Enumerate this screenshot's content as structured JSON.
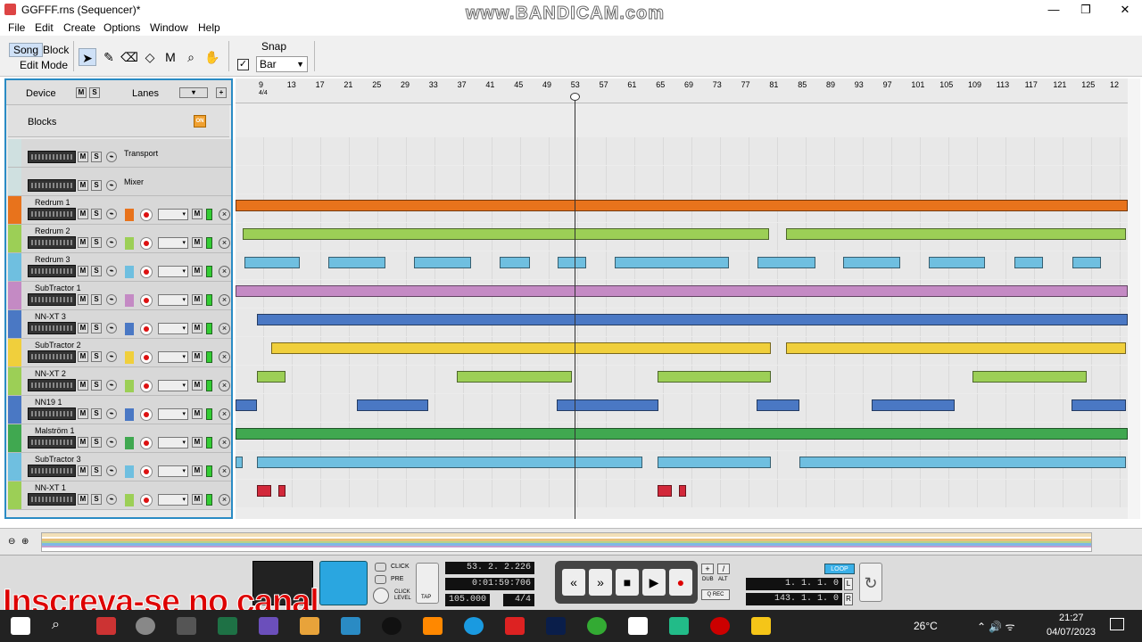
{
  "window": {
    "title": "GGFFF.rns (Sequencer)*",
    "watermark": "www.BANDICAM.com",
    "minimize": "—",
    "maximize": "❐",
    "close": "✕"
  },
  "menu": [
    "File",
    "Edit",
    "Create",
    "Options",
    "Window",
    "Help"
  ],
  "toolbar": {
    "song": "Song",
    "block": "Block",
    "edit_mode": "Edit Mode",
    "snap_label": "Snap",
    "snap_checked": true,
    "snap_value": "Bar"
  },
  "tools": [
    "arrow-tool",
    "pencil-tool",
    "eraser-tool",
    "razor-tool",
    "mute-tool",
    "magnify-tool",
    "hand-tool"
  ],
  "device_panel": {
    "device": "Device",
    "lanes": "Lanes",
    "blocks": "Blocks",
    "blocks_on": "ON"
  },
  "tracks": [
    {
      "name": "Transport",
      "color": "#b0d8d8"
    },
    {
      "name": "Mixer",
      "color": "#b0d8d8"
    },
    {
      "name": "Redrum 1",
      "color": "#e8731c"
    },
    {
      "name": "Redrum 2",
      "color": "#9ccf56"
    },
    {
      "name": "Redrum 3",
      "color": "#6fbfe0"
    },
    {
      "name": "SubTractor 1",
      "color": "#c48ac4"
    },
    {
      "name": "NN-XT 3",
      "color": "#4a78c4"
    },
    {
      "name": "SubTractor 2",
      "color": "#f0cf3c"
    },
    {
      "name": "NN-XT 2",
      "color": "#9ccf56"
    },
    {
      "name": "NN19 1",
      "color": "#4a78c4"
    },
    {
      "name": "Malström 1",
      "color": "#40a850"
    },
    {
      "name": "SubTractor 3",
      "color": "#6fbfe0"
    },
    {
      "name": "NN-XT 1",
      "color": "#9ccf56"
    }
  ],
  "ruler": {
    "bars": [
      "9",
      "13",
      "17",
      "21",
      "25",
      "29",
      "33",
      "37",
      "41",
      "45",
      "49",
      "53",
      "57",
      "61",
      "65",
      "69",
      "73",
      "77",
      "81",
      "85",
      "89",
      "93",
      "97",
      "101",
      "105",
      "109",
      "113",
      "117",
      "121",
      "125",
      "12"
    ],
    "signature": "4/4"
  },
  "transport": {
    "position": "53. 2. 2.226",
    "time": "0:01:59:706",
    "tempo": "105.000",
    "signature": "4/4",
    "left_locator": "1. 1. 1.   0",
    "right_locator": "143. 1. 1.   0",
    "click": "CLICK",
    "pre": "PRE",
    "click_level": "CLICK LEVEL",
    "tap": "TAP",
    "loop": "LOOP",
    "dub": "DUB",
    "alt": "ALT",
    "q_rec": "Q REC",
    "locator_l": "L",
    "locator_r": "R"
  },
  "overlay_text": "Inscreva-se no canal",
  "taskbar": {
    "temperature": "26°C",
    "time": "21:27",
    "date": "04/07/2023"
  }
}
